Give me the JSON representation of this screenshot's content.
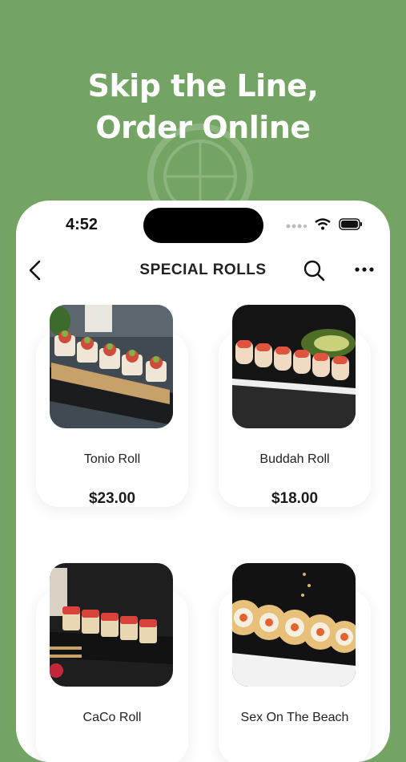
{
  "hero": {
    "line1": "Skip the Line,",
    "line2": "Order Online"
  },
  "status": {
    "time": "4:52"
  },
  "nav": {
    "title": "SPECIAL ROLLS"
  },
  "products": [
    {
      "name": "Tonio Roll",
      "price": "$23.00"
    },
    {
      "name": "Buddah Roll",
      "price": "$18.00"
    },
    {
      "name": "CaCo Roll",
      "price": ""
    },
    {
      "name": "Sex On The Beach",
      "price": ""
    }
  ],
  "colors": {
    "background": "#73a463",
    "card": "#ffffff"
  }
}
